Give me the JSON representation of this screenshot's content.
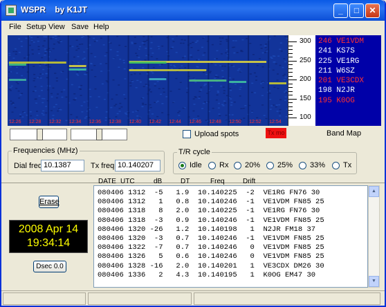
{
  "window": {
    "title": "WSPR    by K1JT"
  },
  "menu": [
    "File",
    "Setup",
    "View",
    "Save",
    "Help"
  ],
  "waterfall": {
    "time_labels": [
      "12:26",
      "12:28",
      "12:32",
      "12:34",
      "12:36",
      "12:38",
      "12:40",
      "12:42",
      "12:44",
      "12:46",
      "12:48",
      "12:50",
      "12:52",
      "12:54"
    ],
    "scale_labels": [
      "300",
      "250",
      "200",
      "150",
      "100"
    ]
  },
  "decodes": [
    {
      "text": "246 VE1VDM",
      "color": "#ff3030"
    },
    {
      "text": "241 KS7S",
      "color": "#ffffff"
    },
    {
      "text": "225 VE1RG",
      "color": "#ffffff"
    },
    {
      "text": "211 W6SZ",
      "color": "#ffffff"
    },
    {
      "text": "201 VE3CDX",
      "color": "#ff3030"
    },
    {
      "text": "198 N2JR",
      "color": "#ffffff"
    },
    {
      "text": "195 K0OG",
      "color": "#ff3030"
    }
  ],
  "controls": {
    "upload_label": "Upload spots",
    "tx_indicator": "Tx mo",
    "band_map": "Band Map"
  },
  "frequencies": {
    "legend": "Frequencies (MHz)",
    "dial_label": "Dial freq:",
    "dial_value": "10.1387",
    "tx_label": "Tx freq:",
    "tx_value": "10.140207"
  },
  "tr_cycle": {
    "legend": "T/R cycle",
    "options": [
      "Idle",
      "Rx",
      "20%",
      "25%",
      "33%",
      "Tx"
    ],
    "selected": "Idle"
  },
  "left": {
    "erase_label": "Erase",
    "clock_date": "2008 Apr 14",
    "clock_time": "19:34:14",
    "dsec_label": "Dsec  0.0"
  },
  "columns": [
    "DATE",
    "UTC",
    "dB",
    "DT",
    "Freq",
    "Drift"
  ],
  "rows": [
    "080406 1312  -5   1.9  10.140225  -2  VE1RG FN76 30",
    "080406 1312   1   0.8  10.140246  -1  VE1VDM FN85 25",
    "080406 1318   8   2.0  10.140225  -1  VE1RG FN76 30",
    "080406 1318  -3   0.9  10.140246  -1  VE1VDM FN85 25",
    "080406 1320 -26   1.2  10.140198   1  N2JR FM18 37",
    "080406 1320  -3   0.7  10.140246  -1  VE1VDM FN85 25",
    "080406 1322  -7   0.7  10.140246   0  VE1VDM FN85 25",
    "080406 1326   5   0.6  10.140246   0  VE1VDM FN85 25",
    "080406 1328 -16   2.0  10.140201   1  VE3CDX DM26 30",
    "080406 1336   2   4.3  10.140195   1  K0OG EM47 30"
  ]
}
